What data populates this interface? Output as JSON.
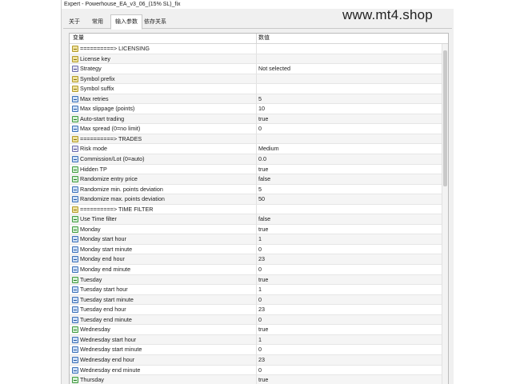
{
  "window": {
    "title": "Expert - Powerhouse_EA_v3_06_(15% SL)_fix"
  },
  "watermark": "www.mt4.shop",
  "tabs": [
    {
      "label": "关于",
      "active": false
    },
    {
      "label": "常用",
      "active": false
    },
    {
      "label": "输入参数",
      "active": true
    },
    {
      "label": "依存关系",
      "active": false
    }
  ],
  "grid": {
    "col_variable": "变量",
    "col_value": "数值",
    "rows": [
      {
        "icon": "str",
        "name": "==========> LICENSING",
        "value": ""
      },
      {
        "icon": "str",
        "name": "License key",
        "value": ""
      },
      {
        "icon": "enum",
        "name": "Strategy",
        "value": "Not selected"
      },
      {
        "icon": "str",
        "name": "Symbol prefix",
        "value": ""
      },
      {
        "icon": "str",
        "name": "Symbol suffix",
        "value": ""
      },
      {
        "icon": "num",
        "name": "Max retries",
        "value": "5"
      },
      {
        "icon": "num",
        "name": "Max slippage (points)",
        "value": "10"
      },
      {
        "icon": "bool",
        "name": "Auto-start trading",
        "value": "true"
      },
      {
        "icon": "num",
        "name": "Max spread (0=no limit)",
        "value": "0"
      },
      {
        "icon": "str",
        "name": "==========> TRADES",
        "value": ""
      },
      {
        "icon": "enum",
        "name": "Risk mode",
        "value": "Medium"
      },
      {
        "icon": "num",
        "name": "Commission/Lot (0=auto)",
        "value": "0.0"
      },
      {
        "icon": "bool",
        "name": "Hidden TP",
        "value": "true"
      },
      {
        "icon": "bool",
        "name": "Randomize entry price",
        "value": "false"
      },
      {
        "icon": "num",
        "name": "Randomize min. points deviation",
        "value": "5"
      },
      {
        "icon": "num",
        "name": "Randomize max. points deviation",
        "value": "50"
      },
      {
        "icon": "str",
        "name": "==========> TIME FILTER",
        "value": ""
      },
      {
        "icon": "bool",
        "name": "Use Time filter",
        "value": "false"
      },
      {
        "icon": "bool",
        "name": "Monday",
        "value": "true"
      },
      {
        "icon": "num",
        "name": "Monday start hour",
        "value": "1"
      },
      {
        "icon": "num",
        "name": "Monday start minute",
        "value": "0"
      },
      {
        "icon": "num",
        "name": "Monday end hour",
        "value": "23"
      },
      {
        "icon": "num",
        "name": "Monday end minute",
        "value": "0"
      },
      {
        "icon": "bool",
        "name": "Tuesday",
        "value": "true"
      },
      {
        "icon": "num",
        "name": "Tuesday start hour",
        "value": "1"
      },
      {
        "icon": "num",
        "name": "Tuesday start minute",
        "value": "0"
      },
      {
        "icon": "num",
        "name": "Tuesday end hour",
        "value": "23"
      },
      {
        "icon": "num",
        "name": "Tuesday end minute",
        "value": "0"
      },
      {
        "icon": "bool",
        "name": "Wednesday",
        "value": "true"
      },
      {
        "icon": "num",
        "name": "Wednesday start hour",
        "value": "1"
      },
      {
        "icon": "num",
        "name": "Wednesday start minute",
        "value": "0"
      },
      {
        "icon": "num",
        "name": "Wednesday end hour",
        "value": "23"
      },
      {
        "icon": "num",
        "name": "Wednesday end minute",
        "value": "0"
      },
      {
        "icon": "bool",
        "name": "Thursday",
        "value": "true"
      }
    ]
  }
}
